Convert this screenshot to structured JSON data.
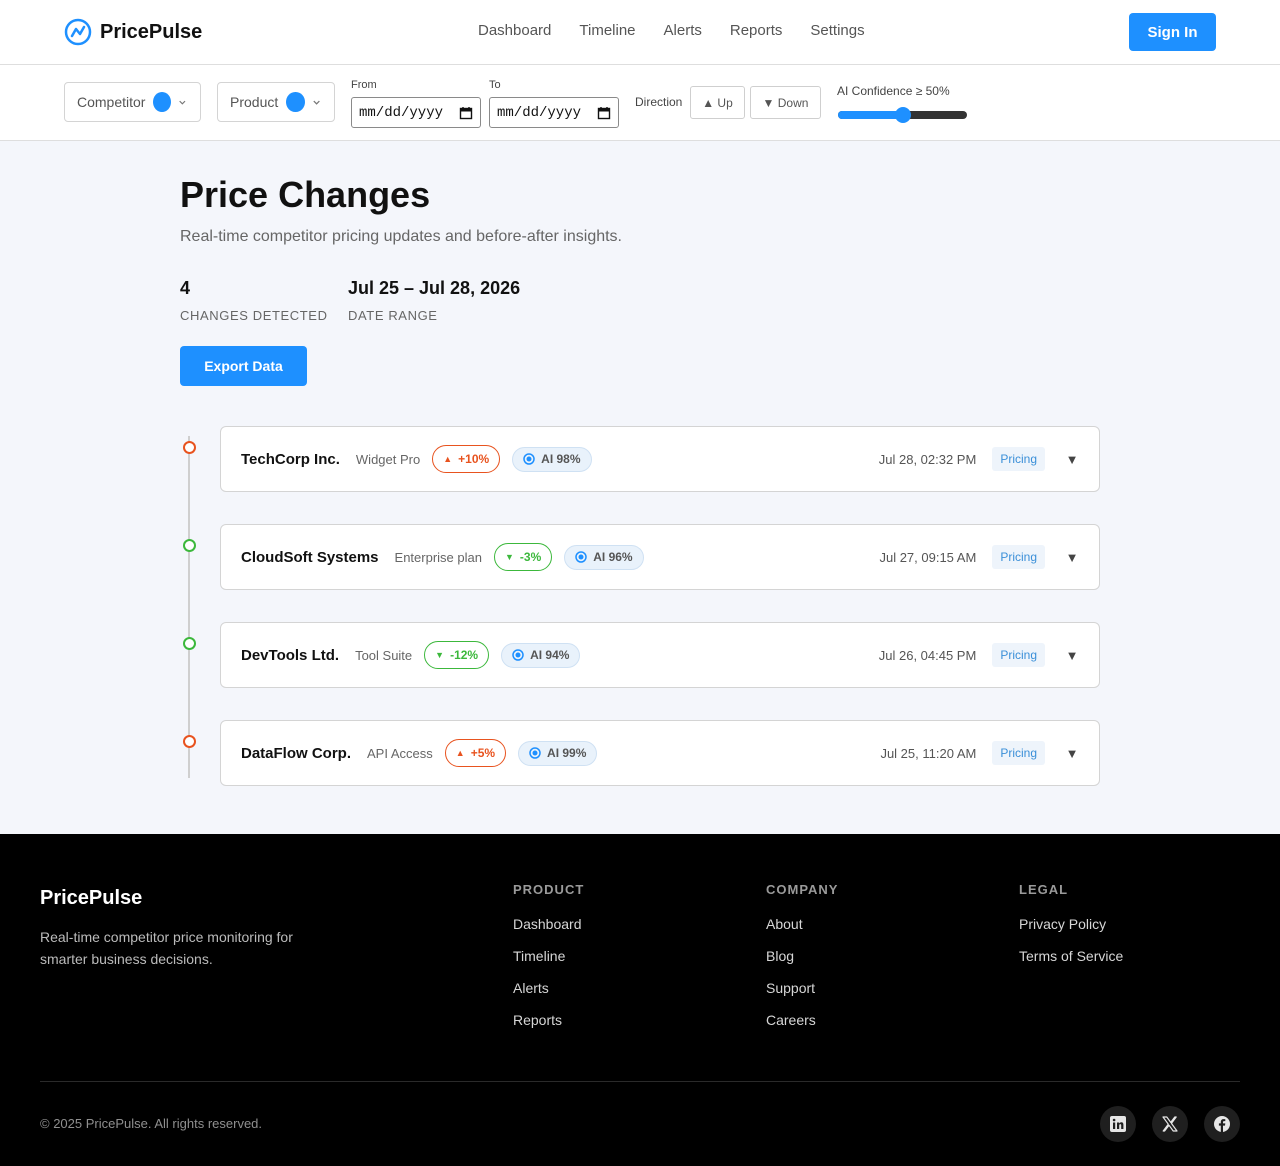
{
  "header": {
    "brand": "PricePulse",
    "nav": [
      "Dashboard",
      "Timeline",
      "Alerts",
      "Reports",
      "Settings"
    ],
    "sign_in": "Sign In"
  },
  "filters": {
    "competitor_label": "Competitor",
    "product_label": "Product",
    "from_label": "From",
    "to_label": "To",
    "from_value": "mm/dd/yyyy",
    "to_value": "mm/dd/yyyy",
    "direction_label": "Direction",
    "up_label": "▲ Up",
    "down_label": "▼ Down",
    "confidence_label": "AI Confidence ≥ 50%",
    "confidence_fraction": 0.5
  },
  "main": {
    "title": "Price Changes",
    "subtitle": "Real-time competitor pricing updates and before-after insights.",
    "stats": [
      {
        "value": "4",
        "label": "CHANGES DETECTED"
      },
      {
        "value": "Jul 25 – Jul 28, 2026",
        "label": "DATE RANGE"
      }
    ],
    "export_label": "Export Data"
  },
  "changes": [
    {
      "competitor": "TechCorp Inc.",
      "product": "Widget Pro",
      "direction": "up",
      "arrow": "▲",
      "change": "+10%",
      "ai": "AI 98%",
      "timestamp": "Jul 28, 02:32 PM",
      "tag": "Pricing"
    },
    {
      "competitor": "CloudSoft Systems",
      "product": "Enterprise plan",
      "direction": "down",
      "arrow": "▼",
      "change": "-3%",
      "ai": "AI 96%",
      "timestamp": "Jul 27, 09:15 AM",
      "tag": "Pricing"
    },
    {
      "competitor": "DevTools Ltd.",
      "product": "Tool Suite",
      "direction": "down",
      "arrow": "▼",
      "change": "-12%",
      "ai": "AI 94%",
      "timestamp": "Jul 26, 04:45 PM",
      "tag": "Pricing"
    },
    {
      "competitor": "DataFlow Corp.",
      "product": "API Access",
      "direction": "up",
      "arrow": "▲",
      "change": "+5%",
      "ai": "AI 99%",
      "timestamp": "Jul 25, 11:20 AM",
      "tag": "Pricing"
    }
  ],
  "expand_glyph": "▼",
  "colors": {
    "accent": "#1e90ff",
    "up": "#e8531f",
    "down": "#3cb83c"
  },
  "footer": {
    "brand": "PricePulse",
    "description": "Real-time competitor price monitoring for smarter business decisions.",
    "columns": [
      {
        "title": "PRODUCT",
        "links": [
          "Dashboard",
          "Timeline",
          "Alerts",
          "Reports"
        ]
      },
      {
        "title": "COMPANY",
        "links": [
          "About",
          "Blog",
          "Support",
          "Careers"
        ]
      },
      {
        "title": "LEGAL",
        "links": [
          "Privacy Policy",
          "Terms of Service"
        ]
      }
    ],
    "copyright": "© 2025 PricePulse. All rights reserved.",
    "social": [
      "linkedin-icon",
      "x-icon",
      "facebook-icon"
    ]
  }
}
